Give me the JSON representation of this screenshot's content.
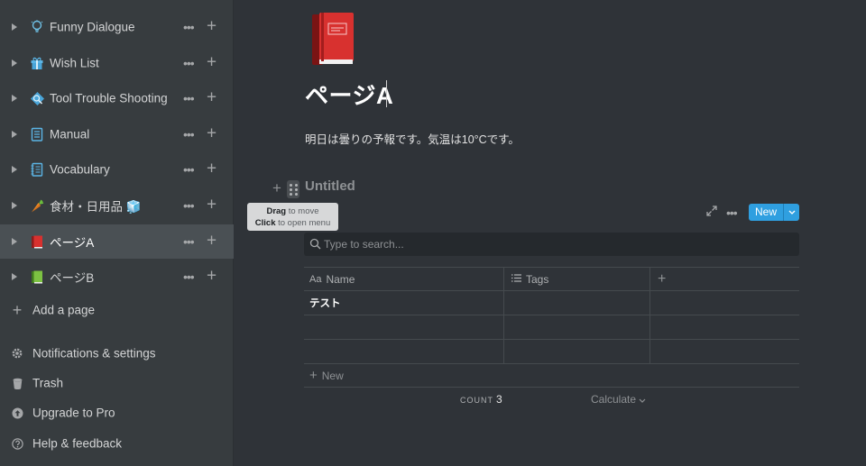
{
  "sidebar": {
    "items": [
      {
        "label": "Funny Dialogue",
        "icon": "lightbulb-icon"
      },
      {
        "label": "Wish List",
        "icon": "gift-icon"
      },
      {
        "label": "Tool Trouble Shooting",
        "icon": "wrench-icon"
      },
      {
        "label": "Manual",
        "icon": "notepad-icon"
      },
      {
        "label": "Vocabulary",
        "icon": "ledger-icon"
      },
      {
        "label": "食材・日用品 🧊",
        "icon": "carrot-icon"
      },
      {
        "label": "ページA",
        "icon": "red-book-icon",
        "active": true
      },
      {
        "label": "ページB",
        "icon": "green-book-icon"
      }
    ],
    "more_symbol": "•••",
    "plus_symbol": "+",
    "add_page": "Add a page",
    "utilities": [
      {
        "label": "Notifications & settings",
        "icon": "gear-icon"
      },
      {
        "label": "Trash",
        "icon": "trash-icon"
      },
      {
        "label": "Upgrade to Pro",
        "icon": "upgrade-arrow-icon"
      },
      {
        "label": "Help & feedback",
        "icon": "question-icon"
      }
    ]
  },
  "page": {
    "icon": "red-book-icon",
    "title": "ページA",
    "body": "明日は曇りの予報です。気温は10°Cです。"
  },
  "database": {
    "title": "Untitled",
    "tooltip": {
      "line1_bold": "Drag",
      "line1_rest": " to move",
      "line2_bold": "Click",
      "line2_rest": " to open menu"
    },
    "new_button": "New",
    "search_placeholder": "Type to search...",
    "columns": [
      {
        "label": "Name",
        "icon": "Aa"
      },
      {
        "label": "Tags",
        "icon": "list-icon"
      }
    ],
    "add_column_symbol": "+",
    "rows": [
      {
        "name": "テスト",
        "tags": ""
      },
      {
        "name": "",
        "tags": ""
      },
      {
        "name": "",
        "tags": ""
      }
    ],
    "new_row_label": "New",
    "count_label": "COUNT",
    "count_value": "3",
    "calculate_label": "Calculate"
  },
  "colors": {
    "sidebar_bg": "#373c3f",
    "main_bg": "#2f3338",
    "accent": "#2f9fe0"
  }
}
